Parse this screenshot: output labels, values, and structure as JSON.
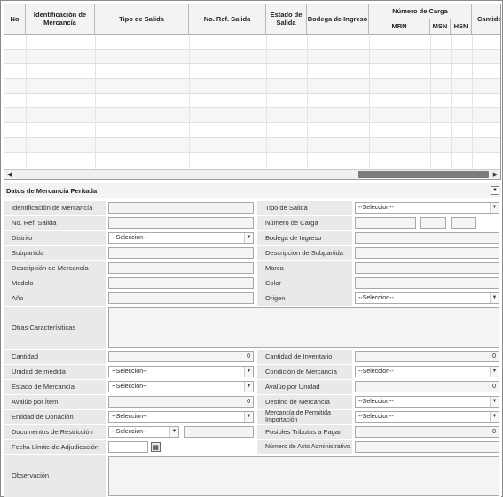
{
  "grid": {
    "columns": {
      "no": "No",
      "identificacion": "Identificación de Mercancía",
      "tipo_salida": "Tipo de Salida",
      "no_ref": "No. Ref. Salida",
      "estado": "Estado de Salida",
      "bodega": "Bodega de Ingreso",
      "numero_carga": "Número de Carga",
      "mrn": "MRN",
      "msn": "MSN",
      "hsn": "HSN",
      "cantidad": "Cantidad"
    },
    "scroll_left": "◀",
    "scroll_right": "▶"
  },
  "section": {
    "title": "Datos de Mercancía Peritada",
    "collapse": "▼"
  },
  "form": {
    "select_default": "--Seleccion--",
    "labels": {
      "identificacion": "Identificación de Mercancía",
      "tipo_salida": "Tipo de Salida",
      "no_ref": "No. Ref. Salida",
      "numero_carga": "Número de Carga",
      "distrito": "Distrito",
      "bodega": "Bodega de Ingreso",
      "subpartida": "Subpartida",
      "desc_subpartida": "Descripción de Subpartida",
      "desc_mercancia": "Descripción de Mercancía",
      "marca": "Marca",
      "modelo": "Modelo",
      "color": "Color",
      "anio": "Año",
      "origen": "Origen",
      "otras": "Otras Caracterísiticas",
      "cantidad": "Cantidad",
      "cantidad_inventario": "Cantidad de Inventario",
      "unidad_medida": "Unidad de medida",
      "condicion": "Condición de Mercancía",
      "estado_mercancia": "Estado de Mercancía",
      "avaluo_unidad": "Avalúo por Unidad",
      "avaluo_item": "Avalúo por Ítem",
      "destino": "Destino de Mercancía",
      "entidad_donacion": "Entidad de Donación",
      "mercancia_permitida": "Mercancía de Permitida Importación",
      "documentos_restriccion": "Documentos de Restricción",
      "posibles_tributos": "Posibles Tributos a Pagar",
      "fecha_limite": "Fecha Límite de Adjudicación",
      "numero_acto": "Número de Acto Administrativo",
      "observacion": "Observación"
    },
    "values": {
      "cantidad": "0",
      "cantidad_inventario": "0",
      "avaluo_unidad": "0",
      "avaluo_item": "0",
      "posibles_tributos": "0"
    },
    "calendar_icon": "▦",
    "arrow": "▼"
  }
}
